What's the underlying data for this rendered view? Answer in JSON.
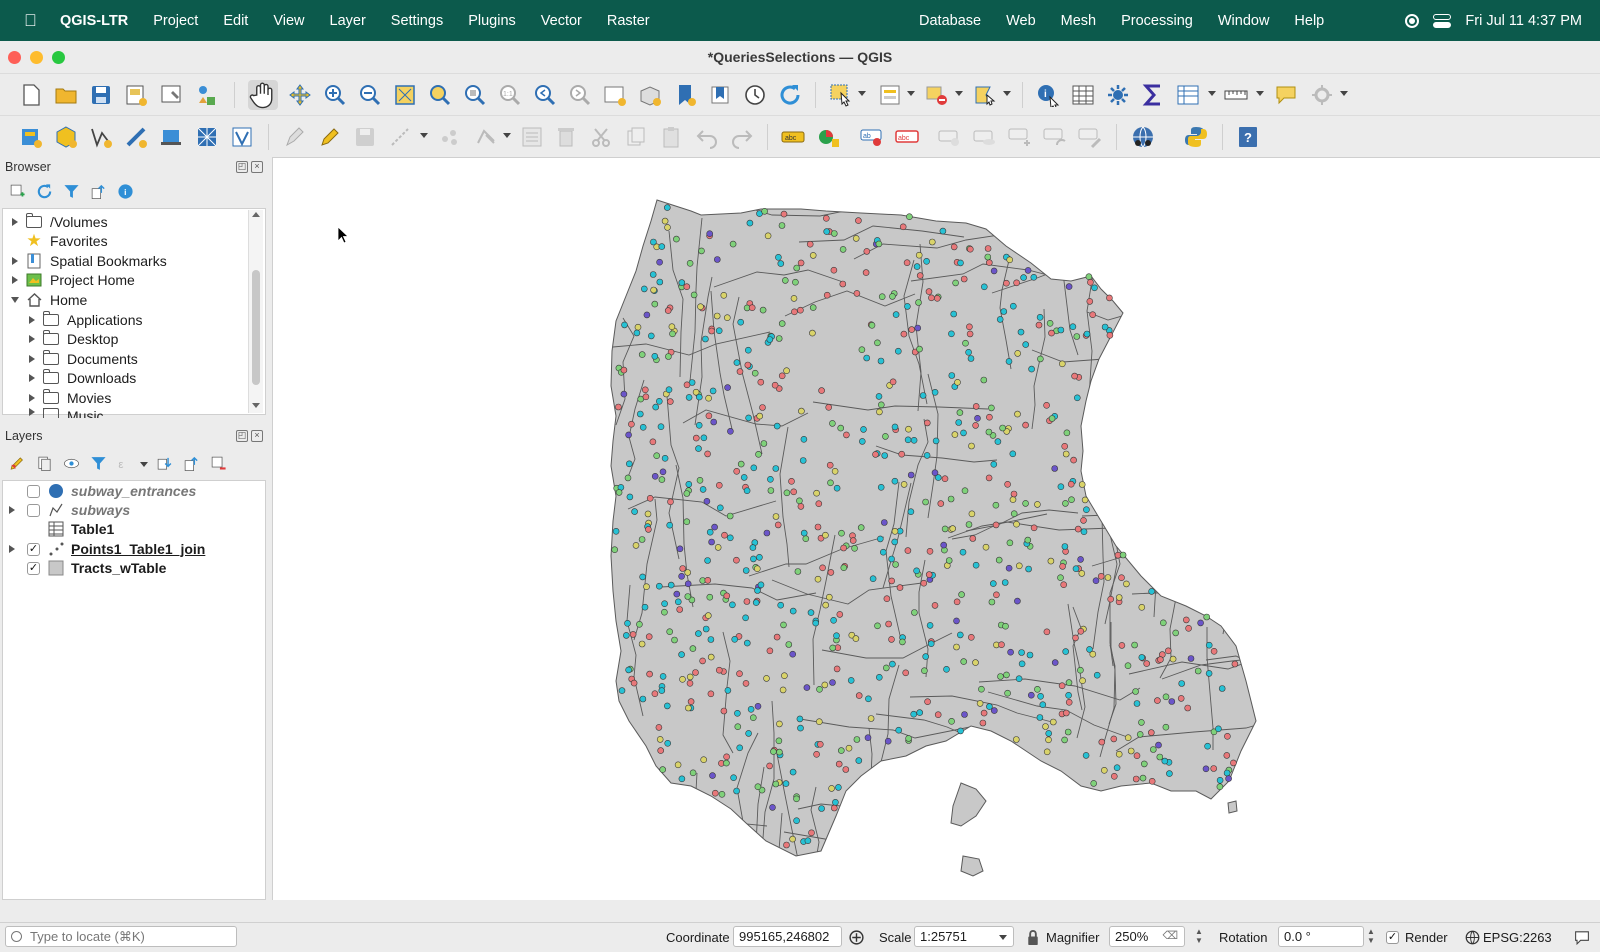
{
  "menubar": {
    "app_name": "QGIS-LTR",
    "left_menus": [
      "Project",
      "Edit",
      "View",
      "Layer",
      "Settings",
      "Plugins",
      "Vector",
      "Raster"
    ],
    "right_menus": [
      "Database",
      "Web",
      "Mesh",
      "Processing",
      "Window",
      "Help"
    ],
    "clock": "Fri Jul 11  4:37 PM"
  },
  "window": {
    "title": "*QueriesSelections — QGIS"
  },
  "browser": {
    "title": "Browser",
    "items": [
      {
        "label": "/Volumes",
        "icon": "folder-icon",
        "expander": "collapsed"
      },
      {
        "label": "Favorites",
        "icon": "star-icon",
        "expander": "none"
      },
      {
        "label": "Spatial Bookmarks",
        "icon": "bookmark-icon",
        "expander": "collapsed"
      },
      {
        "label": "Project Home",
        "icon": "project-home-icon",
        "expander": "collapsed"
      },
      {
        "label": "Home",
        "icon": "home-icon",
        "expander": "expanded"
      },
      {
        "label": "Applications",
        "icon": "folder-icon",
        "expander": "collapsed"
      },
      {
        "label": "Desktop",
        "icon": "folder-icon",
        "expander": "collapsed"
      },
      {
        "label": "Documents",
        "icon": "folder-icon",
        "expander": "collapsed"
      },
      {
        "label": "Downloads",
        "icon": "folder-icon",
        "expander": "collapsed"
      },
      {
        "label": "Movies",
        "icon": "folder-icon",
        "expander": "collapsed"
      },
      {
        "label": "Music",
        "icon": "folder-icon",
        "expander": "collapsed"
      }
    ]
  },
  "layers": {
    "title": "Layers",
    "items": [
      {
        "name": "subway_entrances",
        "checked": false,
        "italic": true,
        "bold": true,
        "underline": false,
        "icon": "point-symbol-icon",
        "expander": false
      },
      {
        "name": "subways",
        "checked": false,
        "italic": true,
        "bold": true,
        "underline": false,
        "icon": "line-layer-icon",
        "expander": true
      },
      {
        "name": "Table1",
        "checked": null,
        "italic": false,
        "bold": true,
        "underline": false,
        "icon": "table-icon",
        "expander": false
      },
      {
        "name": "Points1_Table1_join",
        "checked": true,
        "italic": false,
        "bold": true,
        "underline": true,
        "icon": "categorized-points-icon",
        "expander": true
      },
      {
        "name": "Tracts_wTable",
        "checked": true,
        "italic": false,
        "bold": true,
        "underline": false,
        "icon": "polygon-fill-icon",
        "expander": false
      }
    ]
  },
  "map": {
    "fill_color": "#c8c8c8",
    "outline_color": "#5a5a5a",
    "point_colors": [
      "#e8787a",
      "#27c1d4",
      "#7fd17a",
      "#d9d36a",
      "#6b55c9"
    ]
  },
  "statusbar": {
    "locate_placeholder": "Type to locate (⌘K)",
    "coordinate_label": "Coordinate",
    "coordinate_value": "995165,246802",
    "scale_label": "Scale",
    "scale_value": "1:25751",
    "magnifier_label": "Magnifier",
    "magnifier_value": "250%",
    "rotation_label": "Rotation",
    "rotation_value": "0.0 °",
    "render_label": "Render",
    "render_checked": true,
    "crs_label": "EPSG:2263"
  }
}
